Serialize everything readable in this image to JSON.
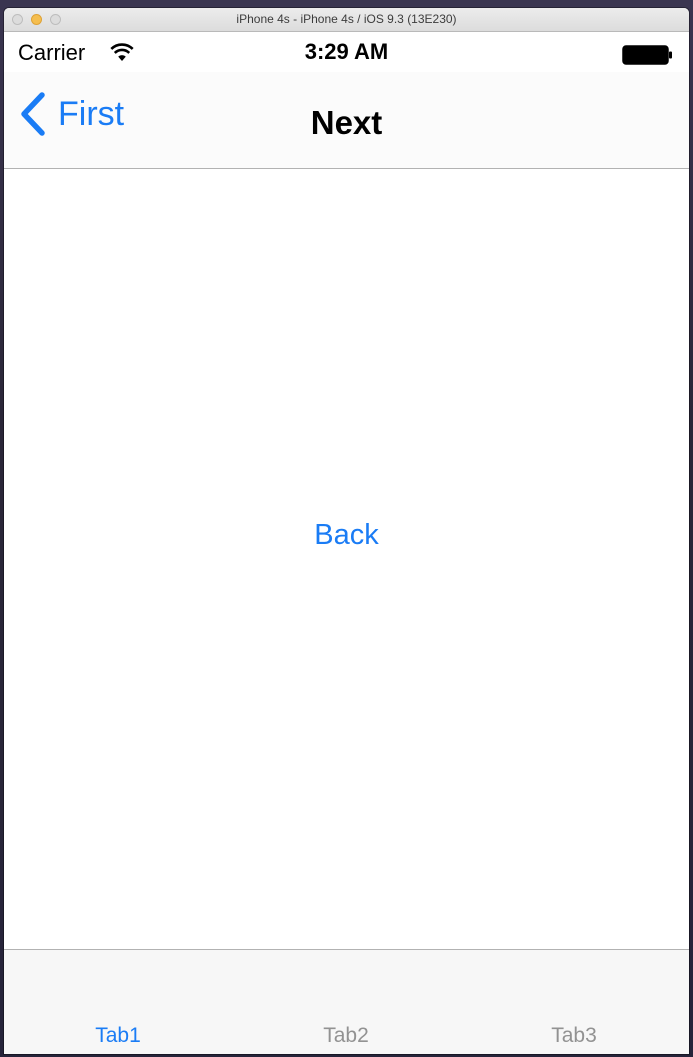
{
  "window": {
    "title": "iPhone 4s - iPhone 4s / iOS 9.3 (13E230)"
  },
  "status_bar": {
    "carrier": "Carrier",
    "time": "3:29 AM",
    "wifi_icon": "wifi-icon",
    "battery_icon": "battery-icon"
  },
  "nav_bar": {
    "back_label": "First",
    "back_icon": "chevron-left-icon",
    "title": "Next"
  },
  "content": {
    "back_button_label": "Back"
  },
  "tab_bar": {
    "tabs": [
      {
        "label": "Tab1",
        "selected": true
      },
      {
        "label": "Tab2",
        "selected": false
      },
      {
        "label": "Tab3",
        "selected": false
      }
    ]
  },
  "colors": {
    "accent": "#1a7cf5",
    "tab_inactive": "#929292",
    "nav_background": "#fbfbfb",
    "tab_background": "#f7f7f7"
  }
}
